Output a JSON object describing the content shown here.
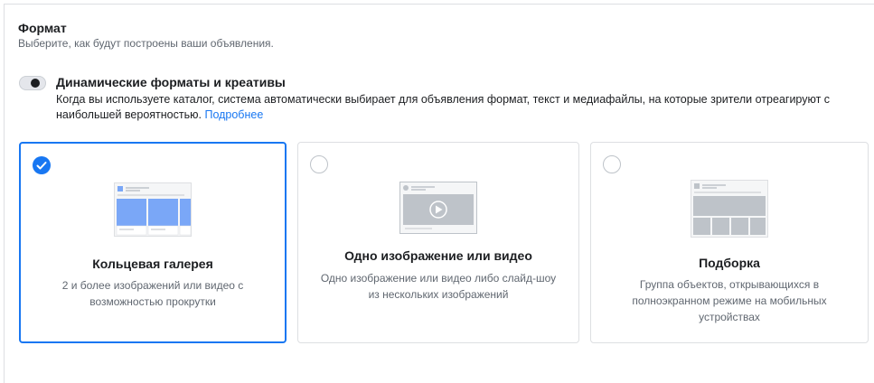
{
  "format_section": {
    "title": "Формат",
    "subtitle": "Выберите, как будут построены ваши объявления."
  },
  "dynamic_formats": {
    "toggle_on": false,
    "title": "Динамические форматы и креативы",
    "description": "Когда вы используете каталог, система автоматически выбирает для объявления формат, текст и медиафайлы, на которые зрители отреагируют с наибольшей вероятностью.",
    "link": "Подробнее"
  },
  "format_options": [
    {
      "title": "Кольцевая галерея",
      "description": "2 и более изображений или видео с возможностью прокрутки",
      "selected": true,
      "icon": "carousel-icon"
    },
    {
      "title": "Одно изображение или видео",
      "description": "Одно изображение или видео либо слайд-шоу из нескольких изображений",
      "selected": false,
      "icon": "single-image-video-icon"
    },
    {
      "title": "Подборка",
      "description": "Группа объектов, открывающихся в полноэкранном режиме на мобильных устройствах",
      "selected": false,
      "icon": "collection-icon"
    }
  ],
  "colors": {
    "accent": "#1877f2",
    "border": "#dddfe2",
    "muted_text": "#606770",
    "illustration_blue": "#7aa7f7",
    "illustration_gray": "#bec3c9"
  }
}
